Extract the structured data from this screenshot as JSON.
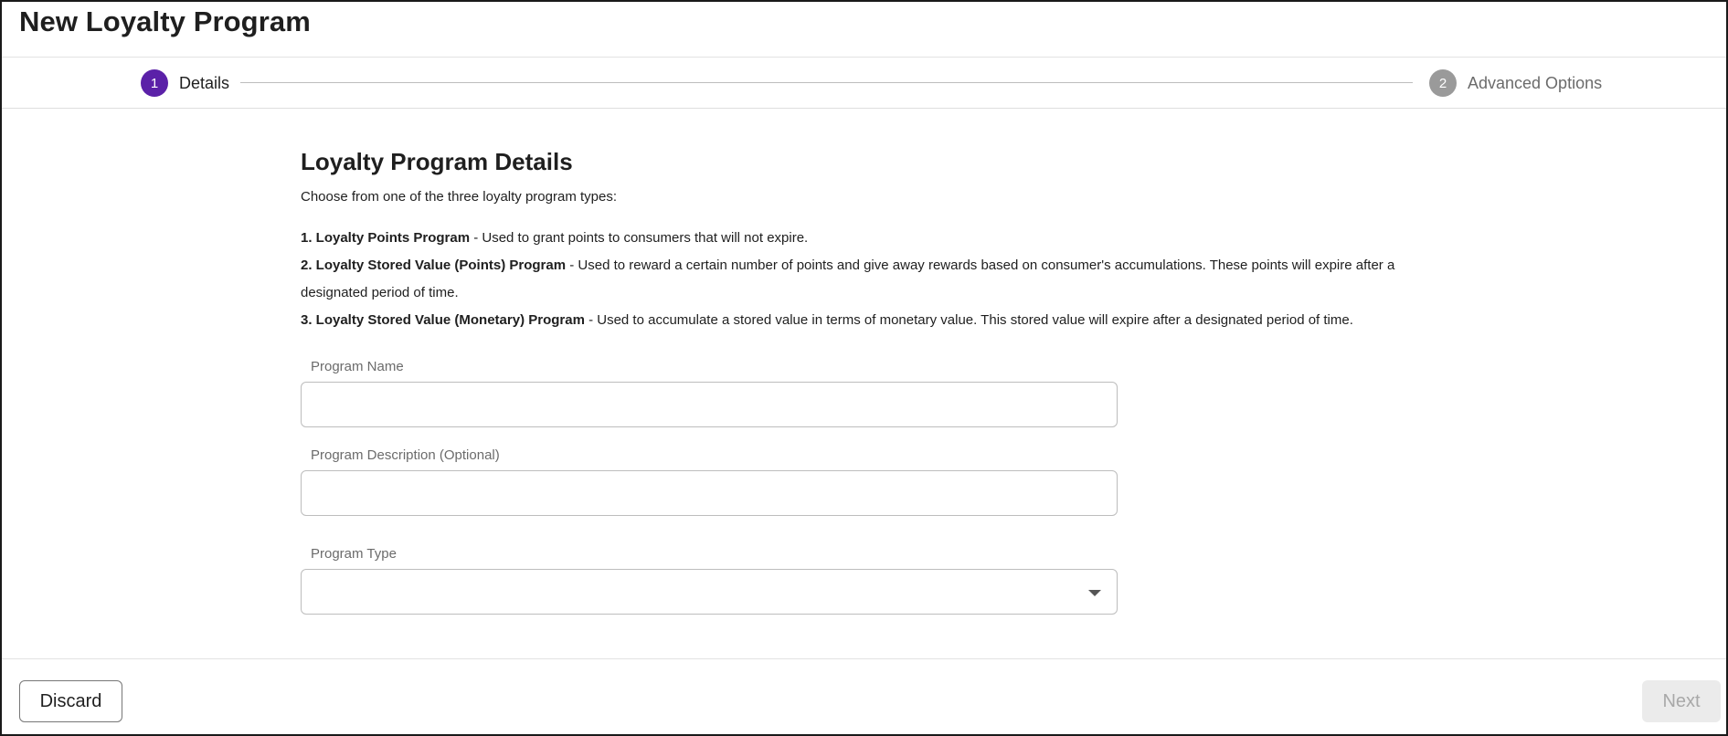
{
  "header": {
    "title": "New Loyalty Program"
  },
  "stepper": {
    "steps": [
      {
        "number": "1",
        "label": "Details",
        "state": "active"
      },
      {
        "number": "2",
        "label": "Advanced Options",
        "state": "inactive"
      }
    ]
  },
  "main": {
    "section_title": "Loyalty Program Details",
    "intro": "Choose from one of the three loyalty program types:",
    "types": [
      {
        "name": "1. Loyalty Points Program",
        "description": " - Used to grant points to consumers that will not expire."
      },
      {
        "name": "2. Loyalty Stored Value (Points) Program",
        "description": " - Used to reward a certain number of points and give away rewards based on consumer's accumulations. These points will expire after a designated period of time."
      },
      {
        "name": "3. Loyalty Stored Value (Monetary) Program",
        "description": " - Used to accumulate a stored value in terms of monetary value. This stored value will expire after a designated period of time."
      }
    ],
    "fields": {
      "program_name": {
        "label": "Program Name",
        "value": ""
      },
      "program_description": {
        "label": "Program Description (Optional)",
        "value": ""
      },
      "program_type": {
        "label": "Program Type",
        "value": ""
      }
    }
  },
  "footer": {
    "discard_label": "Discard",
    "next_label": "Next"
  },
  "colors": {
    "accent": "#5b21a8",
    "inactive_step": "#9a9a9a",
    "disabled_button_bg": "#ebebeb",
    "disabled_button_text": "#a8a8a8"
  },
  "icons": {
    "select_caret": "caret-down-icon"
  }
}
